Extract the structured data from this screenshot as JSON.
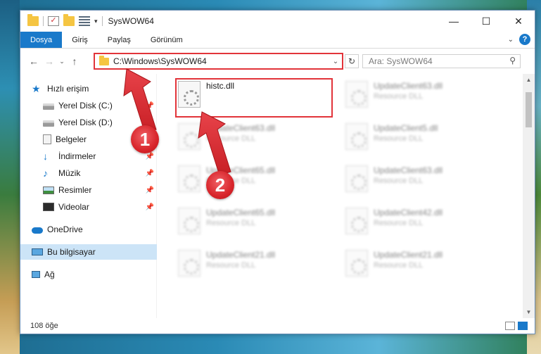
{
  "window": {
    "title": "SysWOW64",
    "controls": {
      "minimize": "—",
      "maximize": "☐",
      "close": "✕"
    }
  },
  "ribbon": {
    "tabs": [
      "Dosya",
      "Giriş",
      "Paylaş",
      "Görünüm"
    ],
    "help": "?"
  },
  "address": {
    "path": "C:\\Windows\\SysWOW64",
    "search_placeholder": "Ara: SysWOW64"
  },
  "sidebar": {
    "items": [
      {
        "label": "Hızlı erişim",
        "icon": "star-icon",
        "pinned": false
      },
      {
        "label": "Yerel Disk (C:)",
        "icon": "drive-icon",
        "pinned": true
      },
      {
        "label": "Yerel Disk (D:)",
        "icon": "drive-icon",
        "pinned": true
      },
      {
        "label": "Belgeler",
        "icon": "documents-icon",
        "pinned": true
      },
      {
        "label": "İndirmeler",
        "icon": "downloads-icon",
        "pinned": true
      },
      {
        "label": "Müzik",
        "icon": "music-icon",
        "pinned": true
      },
      {
        "label": "Resimler",
        "icon": "pictures-icon",
        "pinned": true
      },
      {
        "label": "Videolar",
        "icon": "videos-icon",
        "pinned": true
      },
      {
        "label": "OneDrive",
        "icon": "onedrive-icon",
        "pinned": false
      },
      {
        "label": "Bu bilgisayar",
        "icon": "this-pc-icon",
        "pinned": false,
        "selected": true
      },
      {
        "label": "Ağ",
        "icon": "network-icon",
        "pinned": false
      }
    ]
  },
  "files": [
    {
      "name": "histc.dll",
      "desc": ""
    },
    {
      "name": "UpdateClient63.dll",
      "desc": "Resource DLL"
    },
    {
      "name": "UpdateClient63.dll",
      "desc": "Resource DLL"
    },
    {
      "name": "UpdateClient5.dll",
      "desc": "Resource DLL"
    },
    {
      "name": "UpdateClient65.dll",
      "desc": "Resource DLL"
    },
    {
      "name": "UpdateClient63.dll",
      "desc": "Resource DLL"
    },
    {
      "name": "UpdateClient65.dll",
      "desc": "Resource DLL"
    },
    {
      "name": "UpdateClient42.dll",
      "desc": "Resource DLL"
    },
    {
      "name": "UpdateClient21.dll",
      "desc": "Resource DLL"
    },
    {
      "name": "UpdateClient21.dll",
      "desc": "Resource DLL"
    }
  ],
  "status": {
    "count": "108 öğe"
  },
  "annotations": {
    "step1": "1",
    "step2": "2",
    "color": "#e2343a"
  }
}
